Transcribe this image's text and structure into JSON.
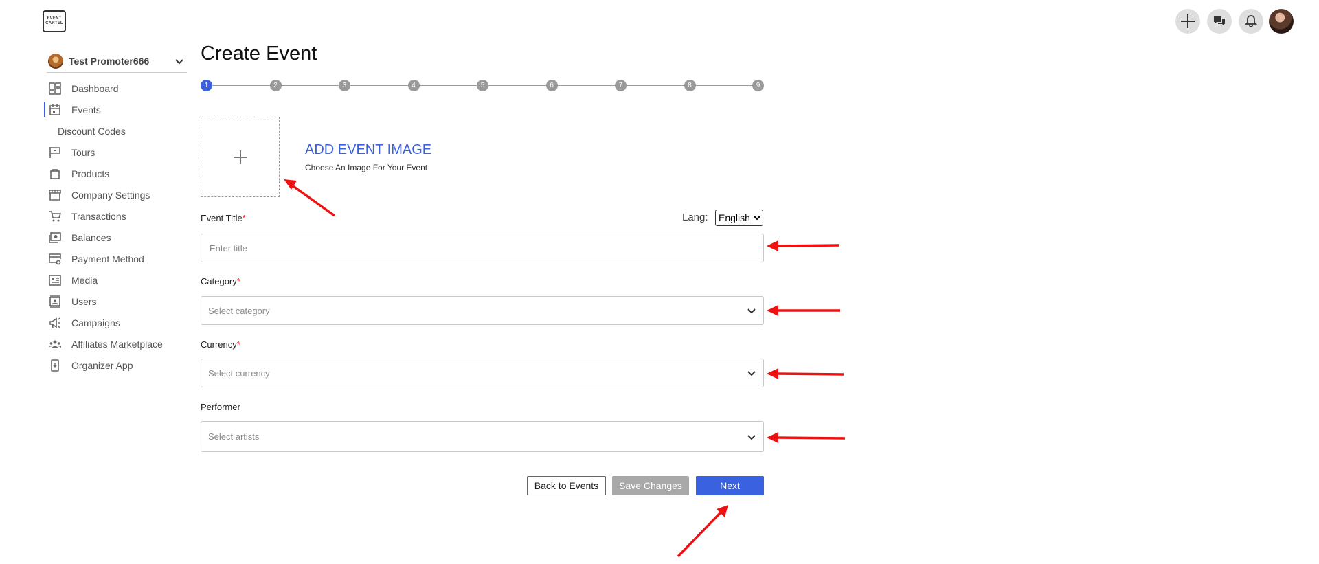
{
  "logo": {
    "text_line1": "EVENT",
    "text_line2": "CARTEL"
  },
  "topbar": {
    "icons": [
      "plus-icon",
      "chat-icon",
      "bell-icon",
      "user-avatar"
    ]
  },
  "sidebar": {
    "org_name": "Test Promoter666",
    "items": [
      {
        "label": "Dashboard",
        "icon": "dashboard-icon"
      },
      {
        "label": "Events",
        "icon": "calendar-icon",
        "active": true
      },
      {
        "label": "Discount Codes",
        "sub": true
      },
      {
        "label": "Tours",
        "icon": "flag-icon"
      },
      {
        "label": "Products",
        "icon": "bag-icon"
      },
      {
        "label": "Company Settings",
        "icon": "store-icon"
      },
      {
        "label": "Transactions",
        "icon": "cart-icon"
      },
      {
        "label": "Balances",
        "icon": "money-icon"
      },
      {
        "label": "Payment Method",
        "icon": "card-gear-icon"
      },
      {
        "label": "Media",
        "icon": "media-icon"
      },
      {
        "label": "Users",
        "icon": "user-badge-icon"
      },
      {
        "label": "Campaigns",
        "icon": "megaphone-icon"
      },
      {
        "label": "Affiliates Marketplace",
        "icon": "group-icon"
      },
      {
        "label": "Organizer App",
        "icon": "phone-icon"
      }
    ]
  },
  "main": {
    "title": "Create Event",
    "steps": [
      "1",
      "2",
      "3",
      "4",
      "5",
      "6",
      "7",
      "8",
      "9"
    ],
    "active_step": 1,
    "image": {
      "title": "ADD EVENT IMAGE",
      "subtitle": "Choose An Image For Your Event"
    },
    "lang": {
      "label": "Lang:",
      "selected": "English"
    },
    "event_title": {
      "label": "Event Title",
      "required": "*",
      "placeholder": "Enter title"
    },
    "category": {
      "label": "Category",
      "required": "*",
      "placeholder": "Select category"
    },
    "currency": {
      "label": "Currency",
      "required": "*",
      "placeholder": "Select currency"
    },
    "performer": {
      "label": "Performer",
      "placeholder": "Select artists"
    },
    "buttons": {
      "back": "Back to Events",
      "save": "Save Changes",
      "next": "Next"
    }
  },
  "colors": {
    "accent": "#3a62e0",
    "annotation_arrow": "#ee1111",
    "required": "#ee2233"
  }
}
